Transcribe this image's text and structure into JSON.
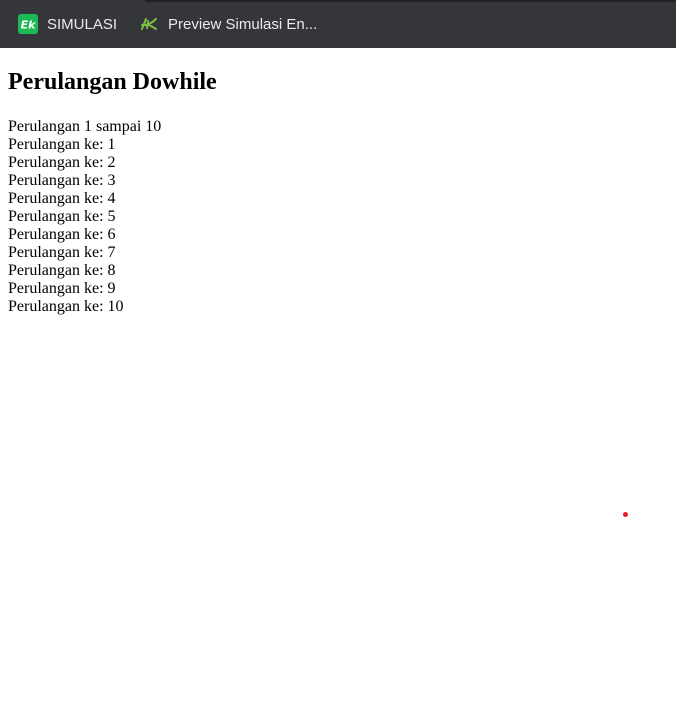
{
  "bookmarks_bar": {
    "items": [
      {
        "label": "SIMULASI",
        "icon": "ek-logo-icon"
      },
      {
        "label": "Preview Simulasi En...",
        "icon": "ek-script-logo-icon"
      }
    ]
  },
  "page": {
    "heading": "Perulangan Dowhile",
    "intro": "Perulangan 1 sampai 10",
    "lines": [
      "Perulangan ke: 1",
      "Perulangan ke: 2",
      "Perulangan ke: 3",
      "Perulangan ke: 4",
      "Perulangan ke: 5",
      "Perulangan ke: 6",
      "Perulangan ke: 7",
      "Perulangan ke: 8",
      "Perulangan ke: 9",
      "Perulangan ke: 10"
    ]
  },
  "colors": {
    "bar_background": "#35363a",
    "bar_text": "#e8eaed",
    "ek_green": "#1db954",
    "cursor_dot": "#e02020"
  }
}
